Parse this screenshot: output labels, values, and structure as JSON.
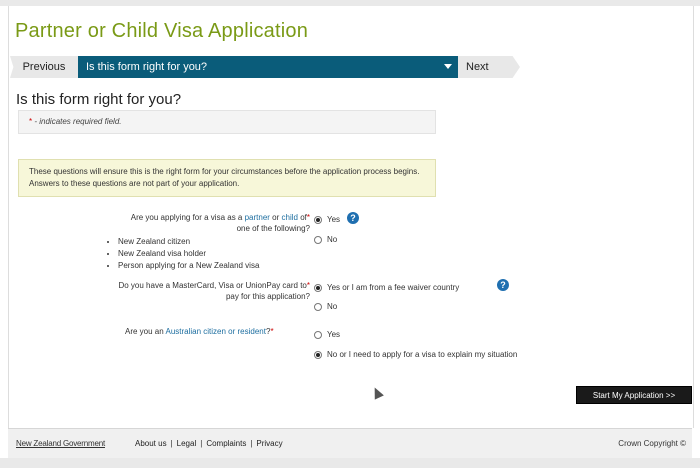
{
  "page": {
    "title": "Partner or Child Visa Application"
  },
  "nav": {
    "previous_label": "Previous",
    "current_label": "Is this form right for you?",
    "next_label": "Next"
  },
  "section": {
    "heading": "Is this form right for you?",
    "required_star": "*",
    "required_text": " - indicates required field."
  },
  "info": {
    "text": "These questions will ensure this is the right form for your circumstances before the application process begins. Answers to these questions are not part of your application."
  },
  "q1": {
    "part1": "Are you applying for a visa as a ",
    "link_partner": "partner",
    "part2": " or ",
    "link_child": "child",
    "part3": " of",
    "star": "*",
    "line2": "one of the following?",
    "bullets": [
      "New Zealand citizen",
      "New Zealand visa holder",
      "Person applying for a New Zealand visa"
    ],
    "options": [
      {
        "label": "Yes",
        "selected": true
      },
      {
        "label": "No",
        "selected": false
      }
    ],
    "help_icon": "?"
  },
  "q2": {
    "line1": "Do you have a MasterCard, Visa or UnionPay card to",
    "star": "*",
    "line2": "pay for this application?",
    "options": [
      {
        "label": "Yes or I am from a fee waiver country",
        "selected": true
      },
      {
        "label": "No",
        "selected": false
      }
    ],
    "help_icon": "?"
  },
  "q3": {
    "part1": "Are you an ",
    "link": "Australian citizen or resident",
    "part2": "?",
    "star": "*",
    "options": [
      {
        "label": "Yes",
        "selected": false
      },
      {
        "label": "No or I need to apply for a visa to explain my situation",
        "selected": true
      }
    ]
  },
  "actions": {
    "start_label": "Start My Application >>"
  },
  "footer": {
    "gov": "New Zealand Government",
    "links": [
      "About us",
      "Legal",
      "Complaints",
      "Privacy"
    ],
    "copyright": "Crown Copyright ©"
  },
  "colors": {
    "title_green": "#7a9a16",
    "nav_blue": "#0a5c7a",
    "link_blue": "#1d6ea0",
    "help_blue": "#1f6fb0",
    "required_red": "#cc0000"
  }
}
